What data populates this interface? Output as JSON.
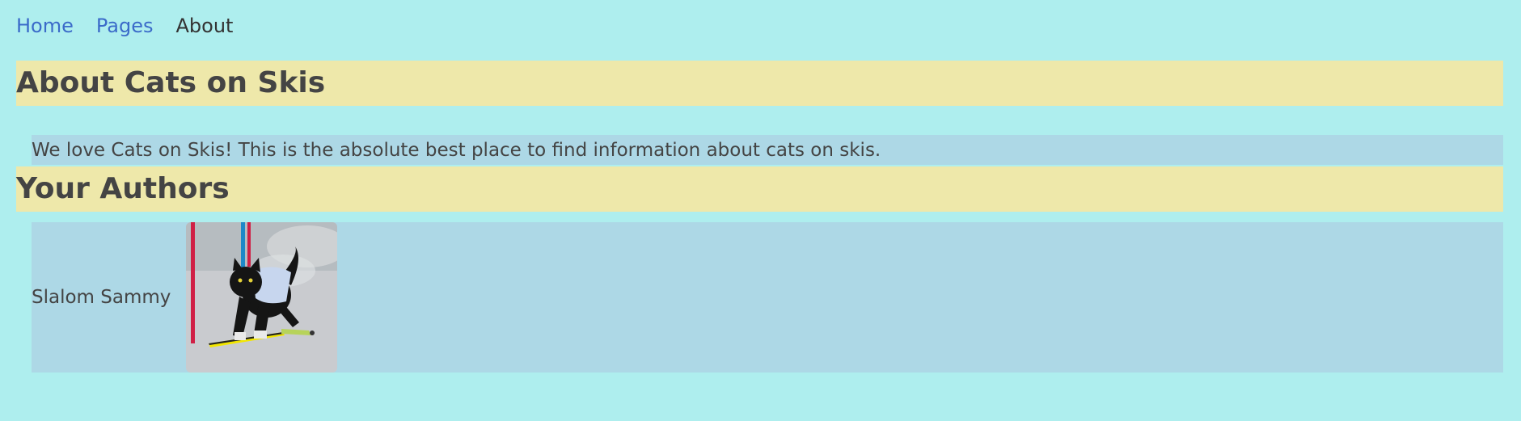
{
  "nav": {
    "home": "Home",
    "pages": "Pages",
    "about": "About"
  },
  "about": {
    "title": "About Cats on Skis",
    "intro": "We love Cats on Skis! This is the absolute best place to find information about cats on skis."
  },
  "authors": {
    "title": "Your Authors",
    "list": [
      {
        "name": "Slalom Sammy",
        "photo_icon": "skiing-cat-photo"
      }
    ]
  },
  "colors": {
    "page_background": "#aeeeee",
    "heading_background": "#eee8aa",
    "panel_background": "#add8e6",
    "link": "#3b6bc9",
    "text": "#444444"
  }
}
